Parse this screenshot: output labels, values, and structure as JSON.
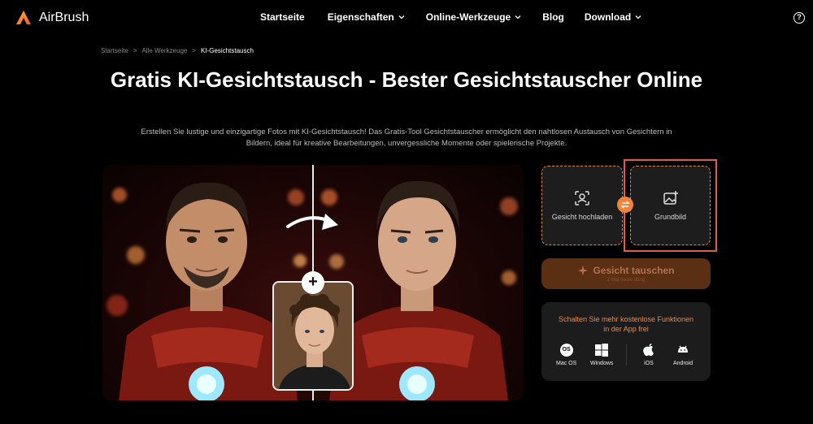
{
  "brand": {
    "name": "AirBrush",
    "accent": "#f0833a"
  },
  "nav": {
    "items": [
      {
        "label": "Startseite",
        "dropdown": false
      },
      {
        "label": "Eigenschaften",
        "dropdown": true
      },
      {
        "label": "Online-Werkzeuge",
        "dropdown": true
      },
      {
        "label": "Blog",
        "dropdown": false
      },
      {
        "label": "Download",
        "dropdown": true
      }
    ],
    "help": "?"
  },
  "breadcrumb": {
    "home": "Startseite",
    "sep": ">",
    "section": "Alle Werkzeuge",
    "current": "KI-Gesichtstausch"
  },
  "page": {
    "title": "Gratis KI-Gesichtstausch - Bester Gesichtstauscher Online",
    "description": "Erstellen Sie lustige und einzigartige Fotos mit KI-Gesichtstausch! Das Gratis-Tool Gesichtstauscher ermöglicht den nahtlosen Austausch von Gesichtern in Bildern, ideal für kreative Bearbeitungen, unvergessliche Momente oder spielerische Projekte."
  },
  "tool": {
    "upload_face": "Gesicht hochladen",
    "base_image": "Grundbild",
    "swap_button": "Gesicht tauschen",
    "swap_sub": "2 Mal heute übrig",
    "app_promo": "Schalten Sie mehr kostenlose Funktionen in der App frei",
    "platforms": [
      "Mac OS",
      "Windows",
      "iOS",
      "Android"
    ],
    "macos_badge": "OS"
  }
}
